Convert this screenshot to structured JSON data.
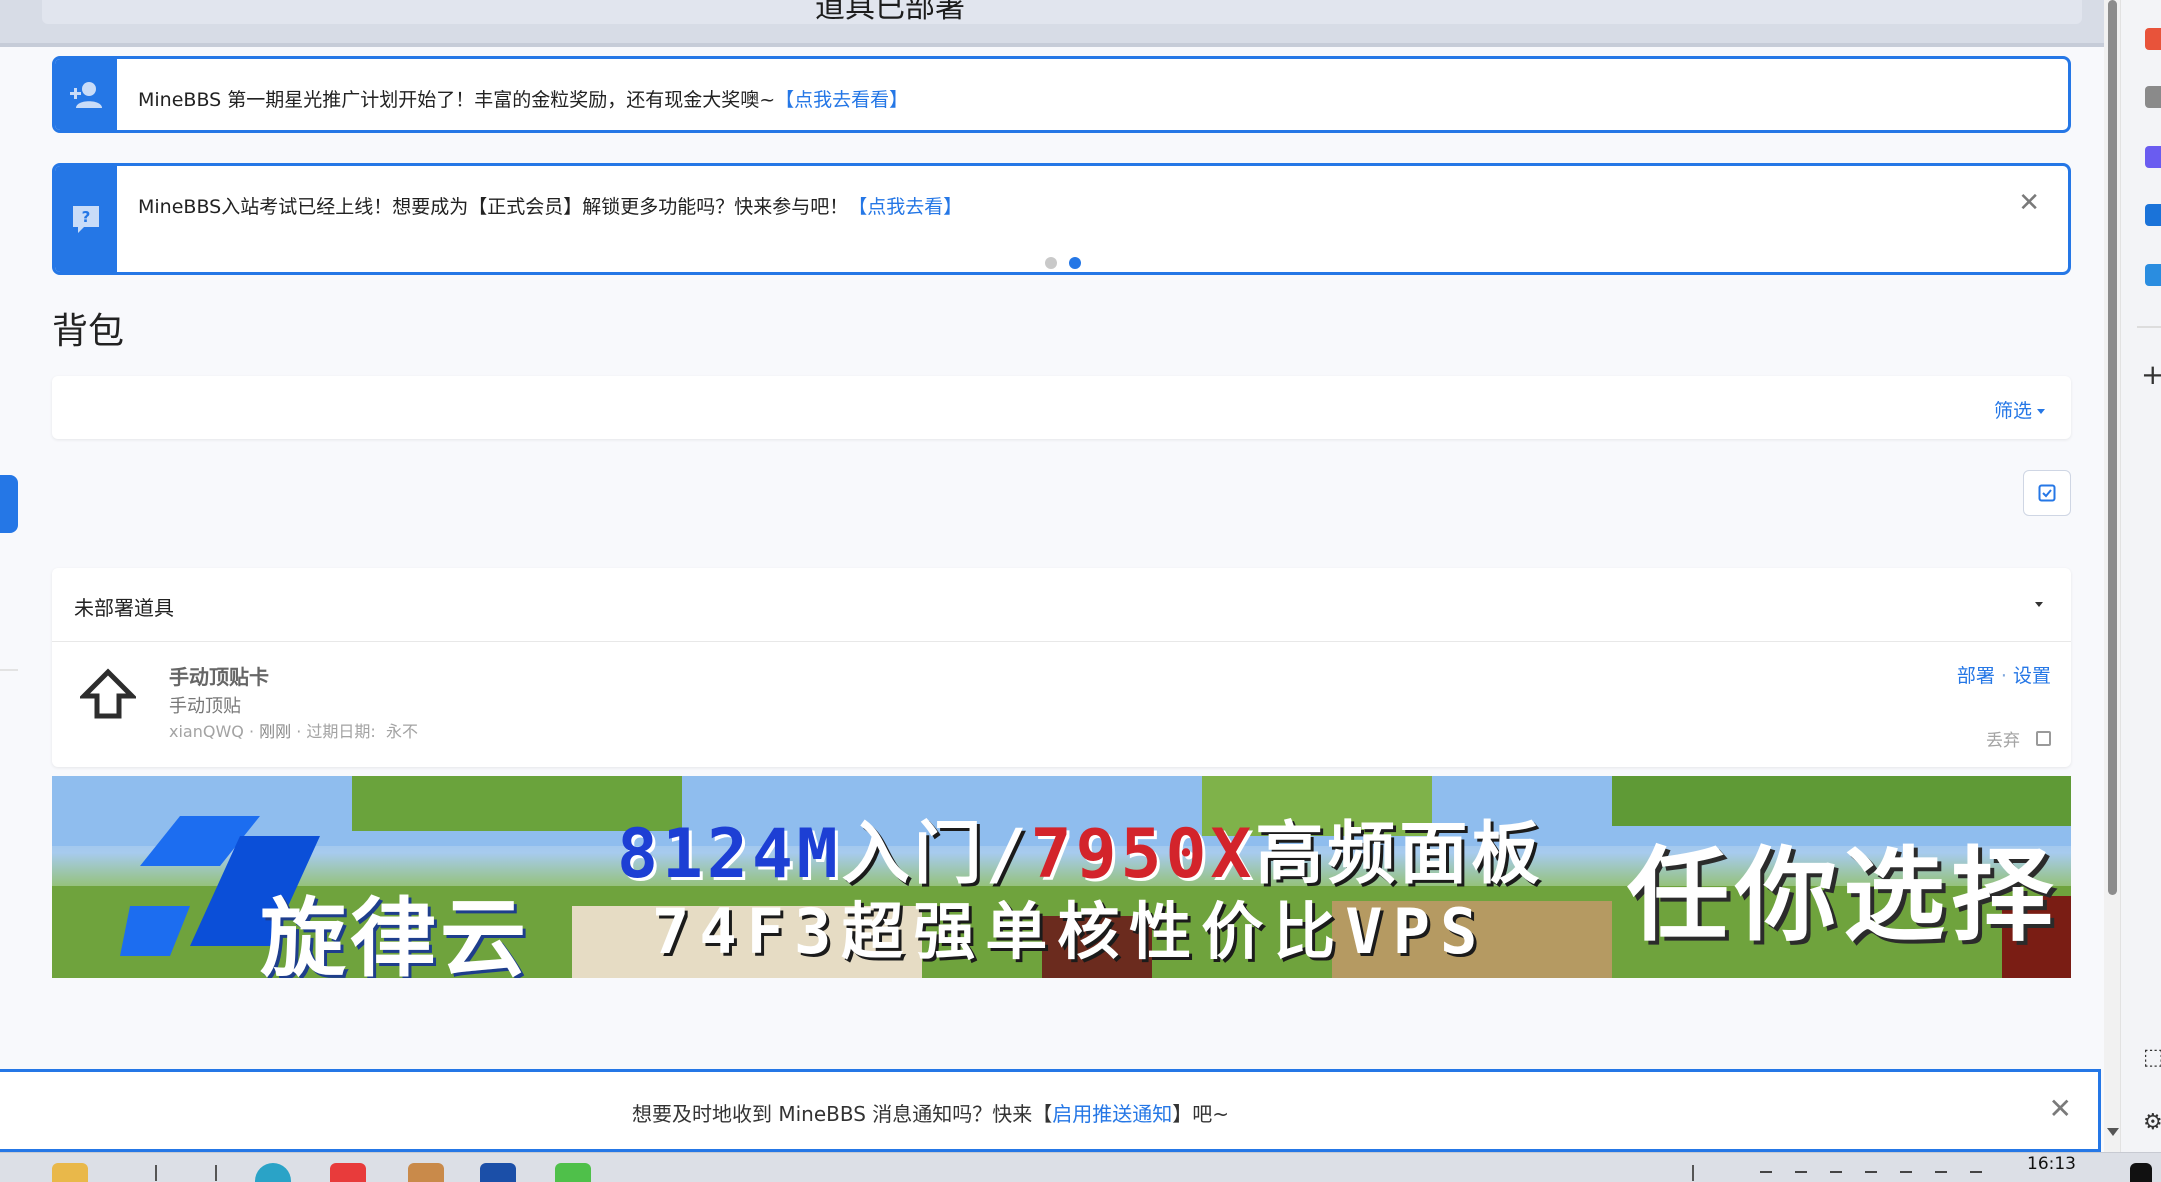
{
  "header": {
    "title": "道具已部署"
  },
  "notices": [
    {
      "text": "MineBBS 第一期星光推广计划开始了！丰富的金粒奖励，还有现金大奖噢~",
      "link": "【点我去看看】",
      "icon": "user-plus-icon"
    },
    {
      "text": "MineBBS入站考试已经上线！想要成为【正式会员】解锁更多功能吗？快来参与吧！",
      "link": "【点我去看】",
      "icon": "question-bubble-icon",
      "close": "✕"
    }
  ],
  "page": {
    "title": "背包"
  },
  "filter": {
    "label": "筛选"
  },
  "section": {
    "title": "未部署道具",
    "items": [
      {
        "name": "手动顶贴卡",
        "description": "手动顶贴",
        "author": "xianQWQ",
        "time": "刚刚",
        "expiry_label": "过期日期:",
        "expiry_value": "永不",
        "action_deploy": "部署",
        "action_separator": "·",
        "action_settings": "设置",
        "discard": "丢弃",
        "icon": "arrow-up-icon"
      }
    ]
  },
  "banner": {
    "brand": "旋律云",
    "line1_part1": "8124M",
    "line1_part2": "入门/",
    "line1_part3": "7950X",
    "line1_part4": "高频面板",
    "line2": "74F3超强单核性价比VPS",
    "slogan": "任你选择"
  },
  "push": {
    "text_before": "想要及时地收到 MineBBS 消息通知吗？快来【",
    "link": "启用推送通知",
    "text_after": "】吧~",
    "close": "✕"
  },
  "taskbar": {
    "time": "16:13"
  },
  "colors": {
    "accent": "#2577e6"
  }
}
